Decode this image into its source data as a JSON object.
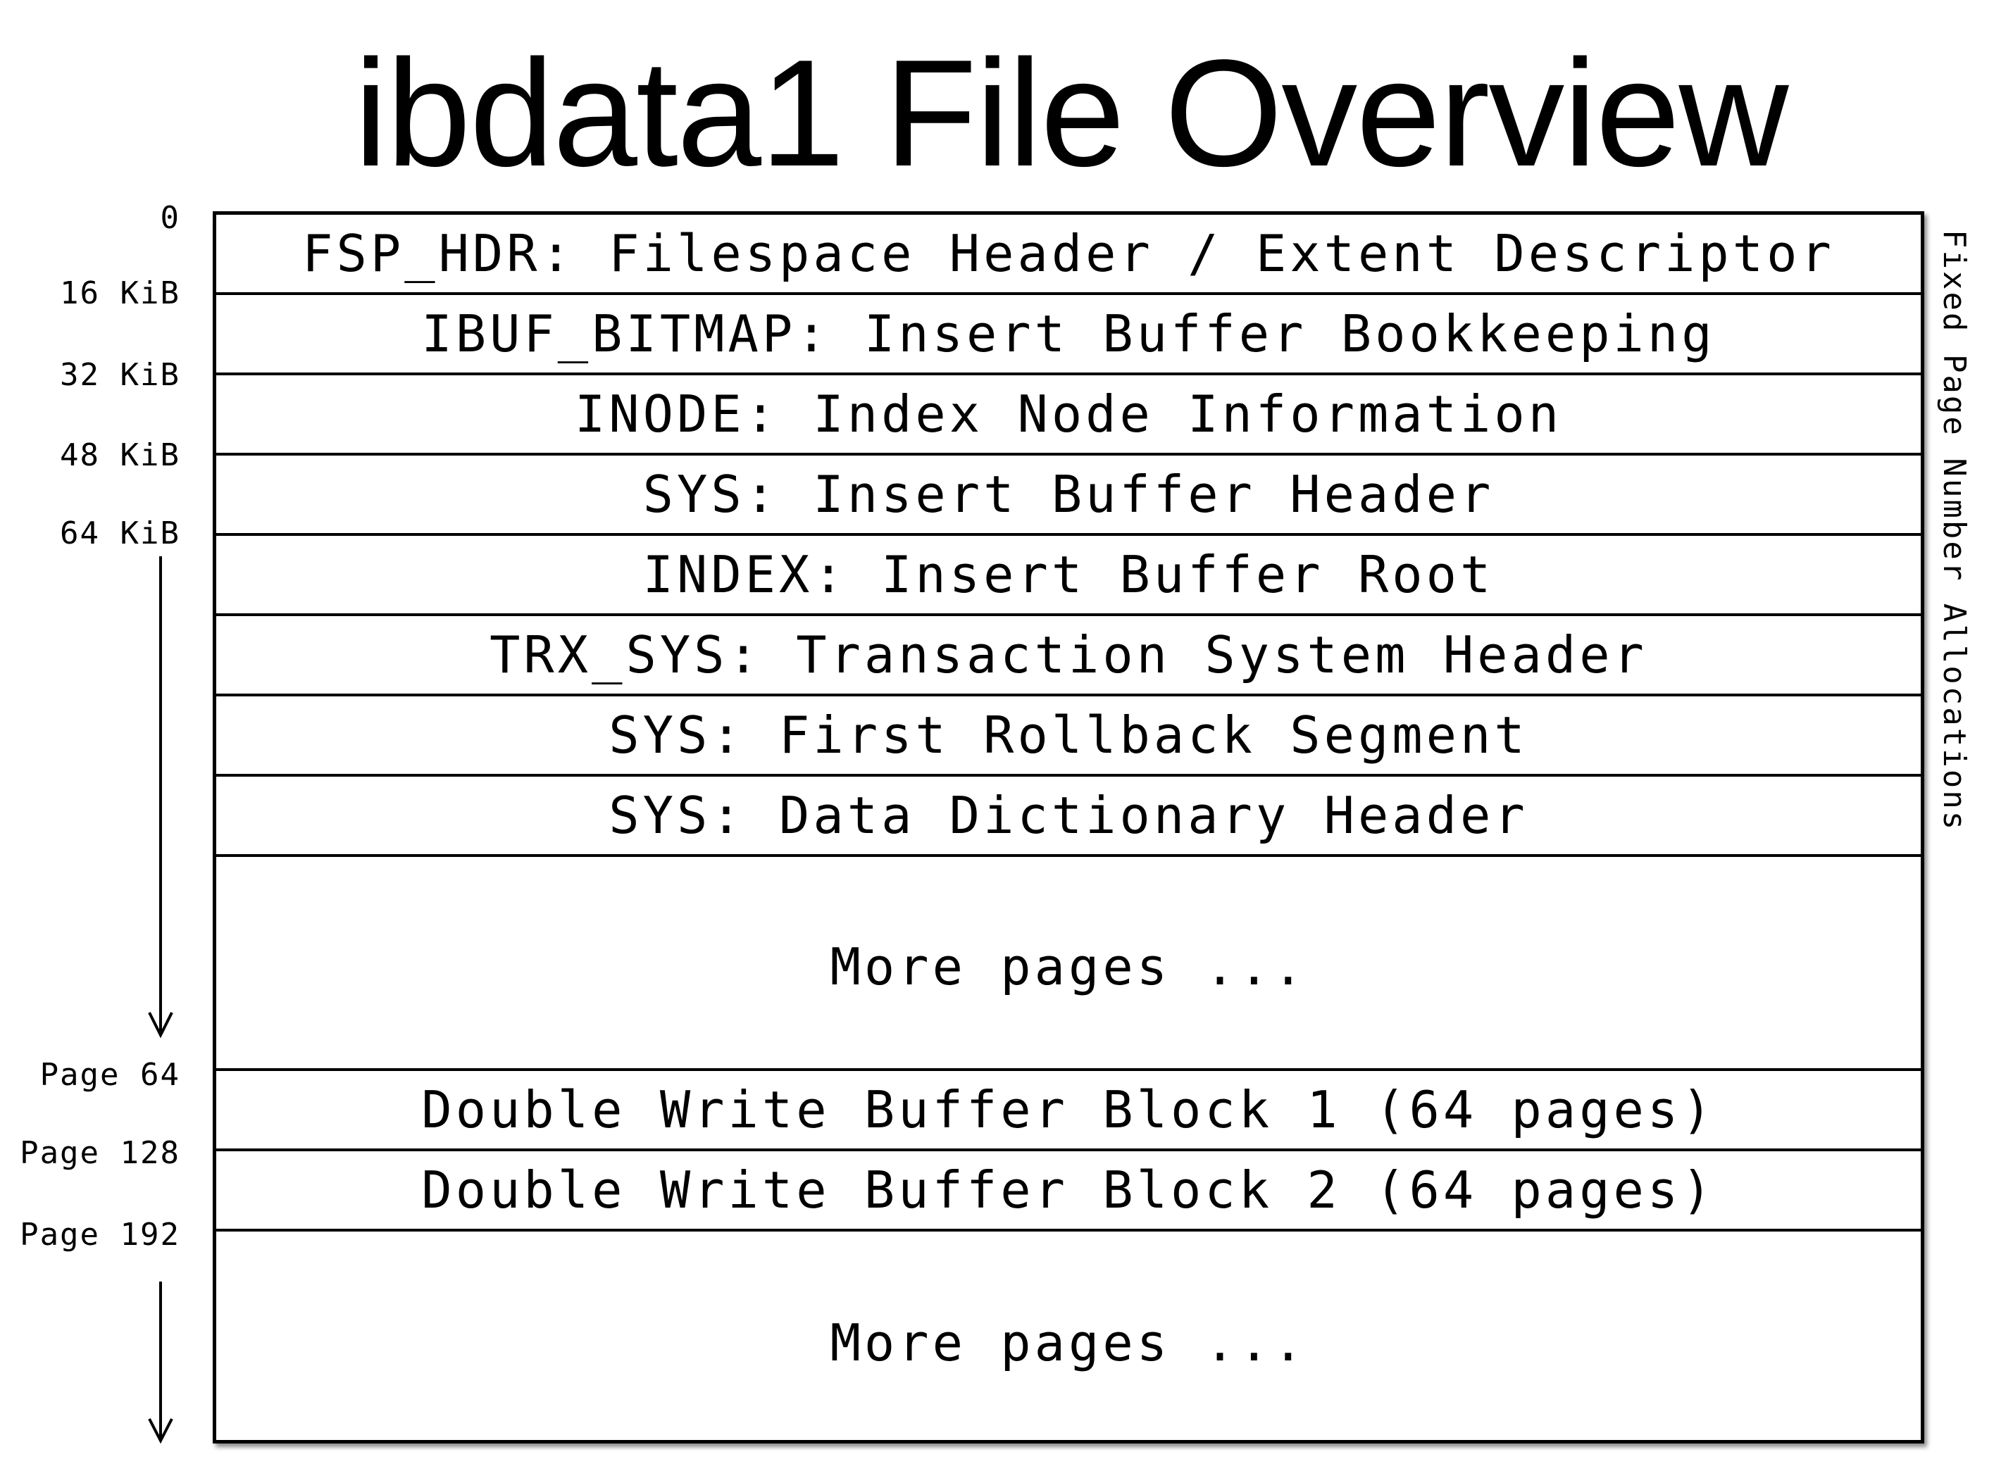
{
  "title": "ibdata1 File Overview",
  "side_label": "Fixed Page Number Allocations",
  "offsets": [
    "0",
    "16 KiB",
    "32 KiB",
    "48 KiB",
    "64 KiB",
    "Page 64",
    "Page 128",
    "Page 192"
  ],
  "pages": [
    "FSP_HDR: Filespace Header / Extent Descriptor",
    "IBUF_BITMAP: Insert Buffer Bookkeeping",
    "INODE: Index Node Information",
    "SYS: Insert Buffer Header",
    "INDEX: Insert Buffer Root",
    "TRX_SYS: Transaction System Header",
    "SYS: First Rollback Segment",
    "SYS: Data Dictionary Header",
    "More pages ...",
    "Double Write Buffer Block 1 (64 pages)",
    "Double Write Buffer Block 2 (64 pages)",
    "More pages ..."
  ]
}
